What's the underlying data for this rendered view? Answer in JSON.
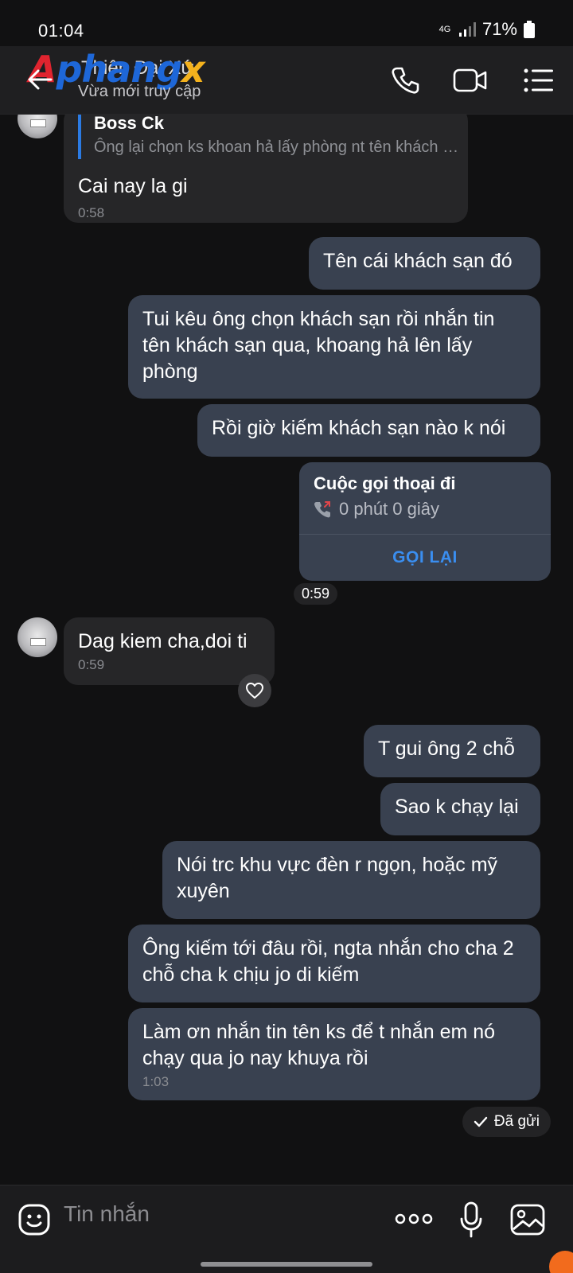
{
  "status_bar": {
    "time": "01:04",
    "network": "4G",
    "battery": "71%"
  },
  "header": {
    "logo": {
      "part_a": "A",
      "part_b": "phang",
      "part_c": "x"
    },
    "contact_name": "Thiên Đại Xứ",
    "contact_status": "Vừa mới truy cập",
    "icons": [
      "back-arrow-icon",
      "phone-icon",
      "video-call-icon",
      "menu-list-icon"
    ]
  },
  "messages": [
    {
      "id": "m1",
      "dir": "in",
      "reply_to": {
        "name": "Boss Ck",
        "text": "Ông lại chọn ks khoan hả lấy phòng nt tên khách sạn qua"
      },
      "text": "Cai nay la gi",
      "time": "0:58"
    },
    {
      "id": "m2",
      "dir": "out",
      "text": "Tên cái khách sạn đó"
    },
    {
      "id": "m3",
      "dir": "out",
      "text": "Tui kêu ông chọn khách sạn rồi nhắn tin tên khách sạn qua, khoang hả lên lấy phòng"
    },
    {
      "id": "m4",
      "dir": "out",
      "text": "Rồi giờ kiếm khách sạn nào k nói"
    },
    {
      "id": "m5",
      "dir": "out",
      "type": "call",
      "title": "Cuộc gọi thoại đi",
      "duration": "0 phút 0 giây",
      "action": "GỌI LẠI",
      "time": "0:59"
    },
    {
      "id": "m6",
      "dir": "in",
      "text": "Dag kiem cha,doi ti",
      "time": "0:59"
    },
    {
      "id": "m7",
      "dir": "out",
      "text": "T gui ông 2 chỗ"
    },
    {
      "id": "m8",
      "dir": "out",
      "text": "Sao k chạy lại"
    },
    {
      "id": "m9",
      "dir": "out",
      "text": "Nói trc khu vực đèn r ngọn, hoặc mỹ xuyên"
    },
    {
      "id": "m10",
      "dir": "out",
      "text": "Ông kiếm tới đâu rồi, ngta nhắn cho cha 2 chỗ cha k chịu jo di kiếm"
    },
    {
      "id": "m11",
      "dir": "out",
      "text": "Làm ơn nhắn tin tên ks để t nhắn em nó chạy qua jo nay khuya rồi",
      "time": "1:03"
    }
  ],
  "sent_status": "Đã gửi",
  "composer": {
    "placeholder": "Tin nhắn",
    "icons": [
      "emoji-icon",
      "more-icon",
      "microphone-icon",
      "image-icon"
    ]
  }
}
